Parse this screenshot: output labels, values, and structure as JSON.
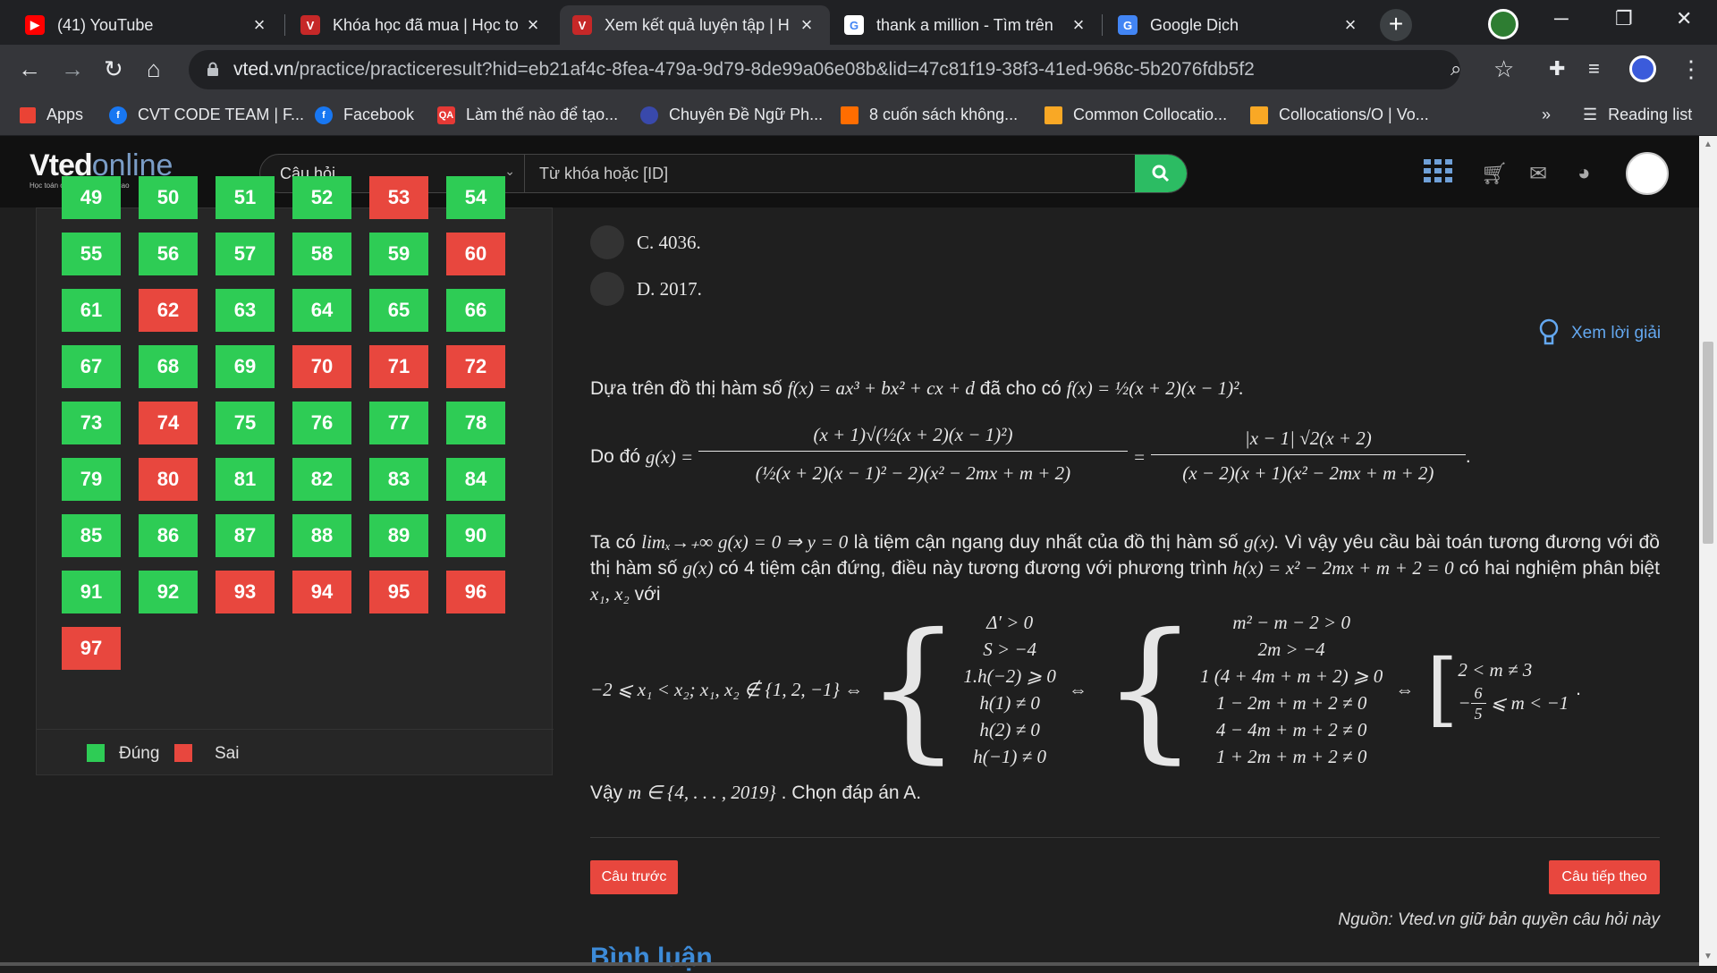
{
  "browser": {
    "tabs": [
      {
        "title": "(41) YouTube",
        "favicon": "youtube-icon",
        "color": "#ff0000"
      },
      {
        "title": "Khóa học đã mua | Học to",
        "favicon": "vted-icon",
        "color": "#c62828"
      },
      {
        "title": "Xem kết quả luyện tập | H",
        "favicon": "vted-icon",
        "color": "#c62828"
      },
      {
        "title": "thank a million - Tìm trên",
        "favicon": "google-icon",
        "color": "#4285f4"
      },
      {
        "title": "Google Dịch",
        "favicon": "google-translate-icon",
        "color": "#4285f4"
      }
    ],
    "url_host": "vted.vn",
    "url_path": "/practice/practiceresult?hid=eb21af4c-8fea-479a-9d79-8de99a06e08b&lid=47c81f19-38f3-41ed-968c-5b2076fdb5f2",
    "bookmarks": [
      {
        "label": "Apps",
        "icon": "apps-grid-icon"
      },
      {
        "label": "CVT CODE TEAM | F...",
        "icon": "facebook-icon"
      },
      {
        "label": "Facebook",
        "icon": "facebook-icon"
      },
      {
        "label": "Làm thế nào để tạo...",
        "icon": "qa-icon"
      },
      {
        "label": "Chuyên Đề Ngữ Ph...",
        "icon": "globe-icon"
      },
      {
        "label": "8 cuốn sách không...",
        "icon": "arrow-icon"
      },
      {
        "label": "Common Collocatio...",
        "icon": "bookmark-icon"
      },
      {
        "label": "Collocations/O | Vo...",
        "icon": "bookmark-icon"
      }
    ],
    "more_bookmarks": "»",
    "reading_list": "Reading list"
  },
  "site": {
    "logo_main": "Vted",
    "logo_online": "online",
    "logo_tagline": "Học toán online chất lượng cao",
    "search_select": "Câu hỏi",
    "search_placeholder": "Từ khóa hoặc [ID]"
  },
  "question_grid": {
    "cells": [
      {
        "n": "49",
        "s": "green"
      },
      {
        "n": "50",
        "s": "green"
      },
      {
        "n": "51",
        "s": "green"
      },
      {
        "n": "52",
        "s": "green"
      },
      {
        "n": "53",
        "s": "red"
      },
      {
        "n": "54",
        "s": "green"
      },
      {
        "n": "55",
        "s": "green"
      },
      {
        "n": "56",
        "s": "green"
      },
      {
        "n": "57",
        "s": "green"
      },
      {
        "n": "58",
        "s": "green"
      },
      {
        "n": "59",
        "s": "green"
      },
      {
        "n": "60",
        "s": "red"
      },
      {
        "n": "61",
        "s": "green"
      },
      {
        "n": "62",
        "s": "red"
      },
      {
        "n": "63",
        "s": "green"
      },
      {
        "n": "64",
        "s": "green"
      },
      {
        "n": "65",
        "s": "green"
      },
      {
        "n": "66",
        "s": "green"
      },
      {
        "n": "67",
        "s": "green"
      },
      {
        "n": "68",
        "s": "green"
      },
      {
        "n": "69",
        "s": "green"
      },
      {
        "n": "70",
        "s": "red"
      },
      {
        "n": "71",
        "s": "red"
      },
      {
        "n": "72",
        "s": "red"
      },
      {
        "n": "73",
        "s": "green"
      },
      {
        "n": "74",
        "s": "red"
      },
      {
        "n": "75",
        "s": "green"
      },
      {
        "n": "76",
        "s": "green"
      },
      {
        "n": "77",
        "s": "green"
      },
      {
        "n": "78",
        "s": "green"
      },
      {
        "n": "79",
        "s": "green"
      },
      {
        "n": "80",
        "s": "red"
      },
      {
        "n": "81",
        "s": "green"
      },
      {
        "n": "82",
        "s": "green"
      },
      {
        "n": "83",
        "s": "green"
      },
      {
        "n": "84",
        "s": "green"
      },
      {
        "n": "85",
        "s": "green"
      },
      {
        "n": "86",
        "s": "green"
      },
      {
        "n": "87",
        "s": "green"
      },
      {
        "n": "88",
        "s": "green"
      },
      {
        "n": "89",
        "s": "green"
      },
      {
        "n": "90",
        "s": "green"
      },
      {
        "n": "91",
        "s": "green"
      },
      {
        "n": "92",
        "s": "green"
      },
      {
        "n": "93",
        "s": "red"
      },
      {
        "n": "94",
        "s": "red"
      },
      {
        "n": "95",
        "s": "red"
      },
      {
        "n": "96",
        "s": "red"
      },
      {
        "n": "97",
        "s": "red"
      }
    ],
    "legend_correct": "Đúng",
    "legend_wrong": "Sai",
    "color_correct": "#2ecc55",
    "color_wrong": "#e8473e"
  },
  "answers": {
    "option_c": "C. 4036.",
    "option_d": "D. 2017."
  },
  "solution": {
    "hint_label": "Xem lời giải",
    "p1_text": "Dựa trên đồ thị hàm số",
    "p1_f": "f(x) = ax³ + bx² + cx + d",
    "p1_mid": "đã cho có",
    "p1_f2": "f(x) = ½(x + 2)(x − 1)².",
    "p2_do_do": "Do đó",
    "p2_g": "g(x) =",
    "p2_num1": "(x + 1)√(½(x + 2)(x − 1)²)",
    "p2_den1": "(½(x + 2)(x − 1)² − 2)(x² − 2mx + m + 2)",
    "p2_eq": "=",
    "p2_num2": "|x − 1| √2(x + 2)",
    "p2_den2": "(x − 2)(x + 1)(x² − 2mx + m + 2)",
    "p3_a": "Ta có",
    "p3_lim": "limₓ→₊∞ g(x) = 0 ⇒ y = 0",
    "p3_b": "là tiệm cận ngang duy nhất của đồ thị hàm số",
    "p3_g": "g(x).",
    "p3_c": "Vì vậy yêu cầu bài toán tương đương với đồ thị hàm số",
    "p3_g2": "g(x)",
    "p3_d": "có 4 tiệm cận đứng, điều này tương đương với phương trình",
    "p3_h": "h(x) = x² − 2mx + m + 2 = 0",
    "p3_e": "có hai nghiệm phân biệt",
    "p3_x": "x₁, x₂",
    "p3_f": "với",
    "cond_lhs": "−2 ⩽ x₁ < x₂; x₁, x₂ ∉ {1, 2, −1} ⇔",
    "sys1": [
      "Δ′ > 0",
      "S > −4",
      "1.h(−2) ⩾ 0",
      "h(1) ≠ 0",
      "h(2) ≠ 0",
      "h(−1) ≠ 0"
    ],
    "iff": "⇔",
    "sys2": [
      "m² − m − 2 > 0",
      "2m > −4",
      "1 (4 + 4m + m + 2) ⩾ 0",
      "1 − 2m + m + 2 ≠ 0",
      "4 − 4m + m + 2 ≠ 0",
      "1 + 2m + m + 2 ≠ 0"
    ],
    "iff2": "⇔",
    "res1": "2 < m ≠ 3",
    "res2_pre": "−",
    "res2_num": "6",
    "res2_den": "5",
    "res2_post": "⩽ m < −1",
    "res_dot": ".",
    "conclusion_a": "Vậy",
    "conclusion_m": "m ∈ {4, . . . , 2019}",
    "conclusion_b": ". Chọn đáp án A."
  },
  "nav": {
    "prev_label": "Câu trước",
    "next_label": "Câu tiếp theo"
  },
  "source_note": "Nguồn: Vted.vn giữ bản quyền câu hỏi này",
  "comments_title": "Bình luận"
}
